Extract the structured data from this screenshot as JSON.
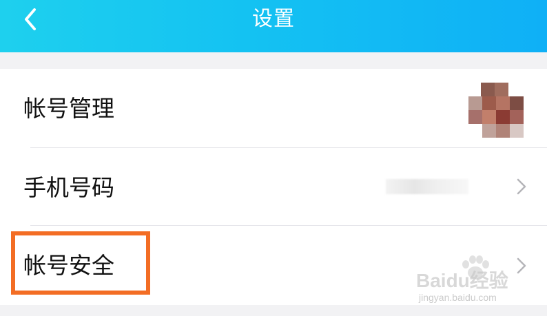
{
  "header": {
    "title": "设置",
    "back_icon": "chevron-left-icon",
    "bg_color": "#14c2f2"
  },
  "rows": [
    {
      "label": "帐号管理",
      "trailing": "blurred-avatar"
    },
    {
      "label": "手机号码",
      "trailing": "chevron-right-icon"
    },
    {
      "label": "帐号安全",
      "trailing": "chevron-right-icon"
    }
  ],
  "highlight_color": "#f36d24",
  "watermark": {
    "main": "Baidu经验",
    "sub": "jingyan.baidu.com"
  }
}
